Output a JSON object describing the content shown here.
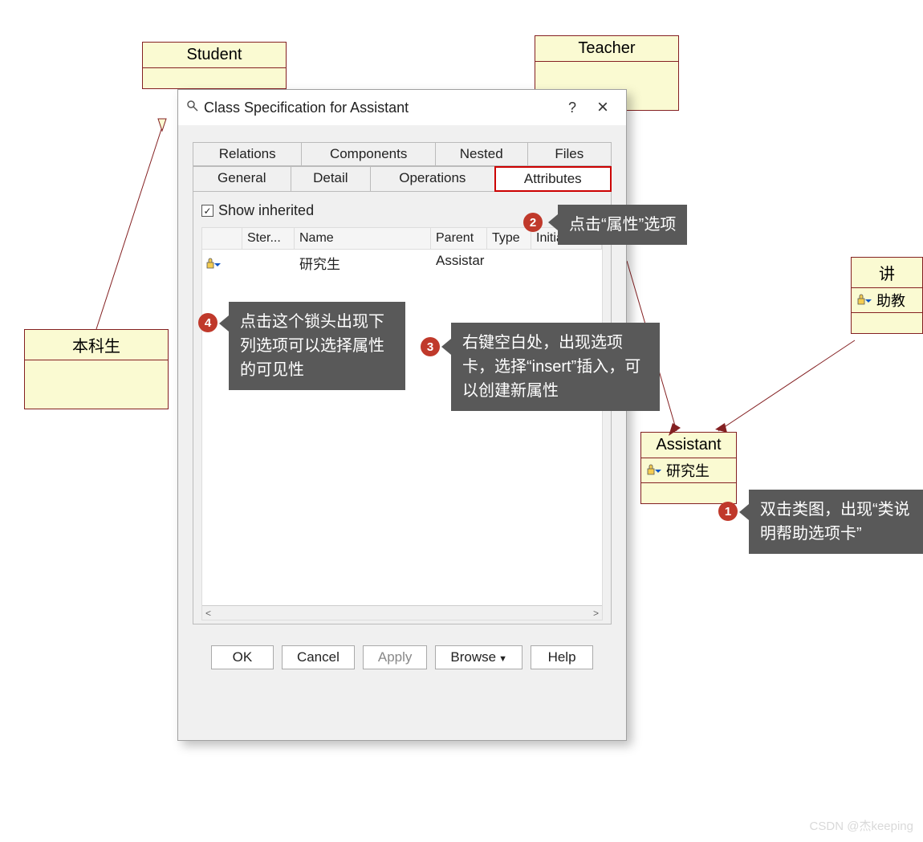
{
  "uml": {
    "student": "Student",
    "teacher": "Teacher",
    "undergrad": "本科生",
    "assistant": "Assistant",
    "assistant_attr": "研究生",
    "right_title": "讲",
    "right_attr": "助教"
  },
  "dialog": {
    "title": "Class Specification for Assistant",
    "help_btn": "?",
    "close_btn": "×",
    "tabs_row1": [
      "Relations",
      "Components",
      "Nested",
      "Files"
    ],
    "tabs_row2": [
      "General",
      "Detail",
      "Operations",
      "Attributes"
    ],
    "active_tab": "Attributes",
    "show_inherited": "Show inherited",
    "columns": {
      "icon": "",
      "ster": "Ster...",
      "name": "Name",
      "parent": "Parent",
      "type": "Type",
      "initial": "Initial"
    },
    "rows": [
      {
        "name": "研究生",
        "parent": "Assistar"
      }
    ],
    "buttons": {
      "ok": "OK",
      "cancel": "Cancel",
      "apply": "Apply",
      "browse": "Browse",
      "help": "Help"
    },
    "scroll_left": "<",
    "scroll_right": ">"
  },
  "callouts": {
    "c1": "双击类图，出现“类说明帮助选项卡”",
    "c2": "点击“属性”选项",
    "c3": "右键空白处，出现选项卡，选择“insert”插入，可以创建新属性",
    "c4": "点击这个锁头出现下列选项可以选择属性的可见性",
    "b1": "1",
    "b2": "2",
    "b3": "3",
    "b4": "4"
  },
  "watermark": "CSDN @杰keeping"
}
